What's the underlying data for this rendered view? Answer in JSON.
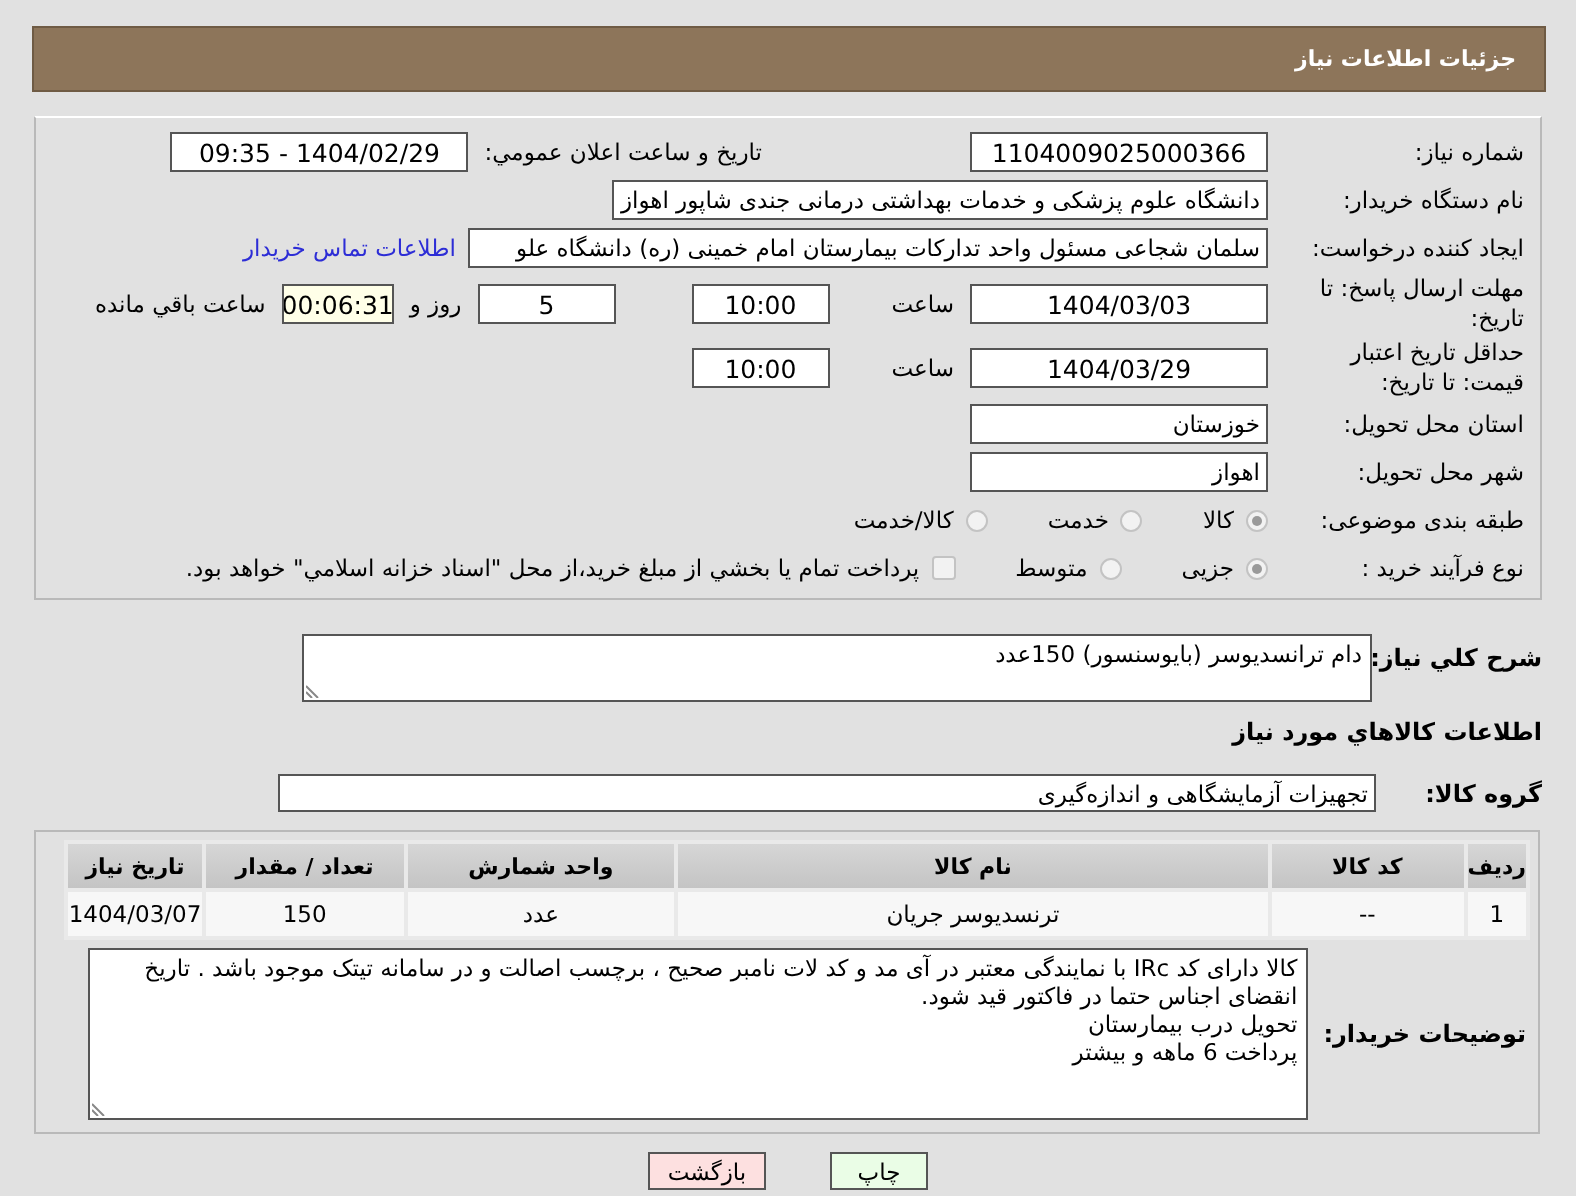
{
  "header": {
    "title": "جزئیات اطلاعات نیاز"
  },
  "details": {
    "need_number": {
      "label": "شماره نیاز:",
      "value": "1104009025000366"
    },
    "announce": {
      "label": "تاريخ و ساعت اعلان عمومي:",
      "value": "1404/02/29 - 09:35"
    },
    "buyer": {
      "label": "نام دستگاه خريدار:",
      "value": "دانشگاه علوم پزشکی و خدمات بهداشتی درمانی جندی شاپور اهواز"
    },
    "requester": {
      "label": "ايجاد كننده درخواست:",
      "value": "سلمان شجاعی مسئول واحد تدارکات بیمارستان امام خمینی (ره) دانشگاه علو",
      "link": "اطلاعات تماس خريدار"
    },
    "deadline": {
      "label": "مهلت ارسال پاسخ: تا تاريخ:",
      "date": "1404/03/03",
      "time_label": "ساعت",
      "time": "10:00",
      "days": "5",
      "days_label": "روز و",
      "remaining": "00:06:31",
      "remaining_label": "ساعت باقي مانده"
    },
    "validity": {
      "label": "حداقل تاريخ اعتبار قيمت: تا تاريخ:",
      "date": "1404/03/29",
      "time_label": "ساعت",
      "time": "10:00"
    },
    "province": {
      "label": "استان محل تحويل:",
      "value": "خوزستان"
    },
    "city": {
      "label": "شهر محل تحويل:",
      "value": "اهواز"
    },
    "category": {
      "label": "طبقه بندی موضوعی:",
      "options": [
        {
          "label": "كالا",
          "selected": true
        },
        {
          "label": "خدمت",
          "selected": false
        },
        {
          "label": "كالا/خدمت",
          "selected": false
        }
      ]
    },
    "process": {
      "label": "نوع فرآيند خريد :",
      "options": [
        {
          "label": "جزیی",
          "selected": true
        },
        {
          "label": "متوسط",
          "selected": false
        }
      ],
      "treasury": {
        "label": "پرداخت تمام يا بخشي از مبلغ خريد،از محل \"اسناد خزانه اسلامي\" خواهد بود.",
        "checked": false
      }
    }
  },
  "description": {
    "label": "شرح كلي نياز:",
    "value": "دام ترانسدیوسر (بایوسنسور)    150عدد"
  },
  "items_heading": "اطلاعات كالاهاي مورد نياز",
  "goods_group": {
    "label": "گروه كالا:",
    "value": "تجهيزات آزمايشگاهی و اندازه‌گيری"
  },
  "table": {
    "columns": [
      "ردیف",
      "کد کالا",
      "نام کالا",
      "واحد شمارش",
      "تعداد / مقدار",
      "تاریخ نیاز"
    ],
    "rows": [
      [
        "1",
        "--",
        "ترنسدیوسر جریان",
        "عدد",
        "150",
        "1404/03/07"
      ]
    ]
  },
  "buyer_notes": {
    "label": "توضيحات خريدار:",
    "value": "کالا دارای کد IRc با نمایندگی معتبر در آی مد و کد لات نامبر صحیح ، برچسب اصالت و در سامانه تیتک موجود باشد . تاریخ انقضای اجناس حتما در فاکتور قید شود.\nتحویل درب بیمارستان\nپرداخت 6 ماهه و بیشتر"
  },
  "buttons": [
    {
      "label": "چاپ",
      "kind": "print"
    },
    {
      "label": "بازگشت",
      "kind": "back"
    }
  ]
}
